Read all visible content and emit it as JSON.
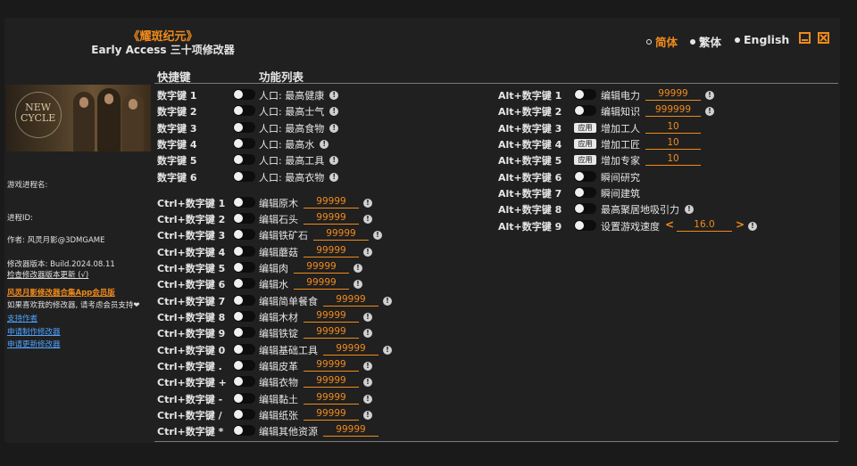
{
  "title": {
    "main": "《耀斑纪元》",
    "sub": "Early Access 三十项修改器"
  },
  "languages": [
    {
      "label": "简体",
      "selected": true
    },
    {
      "label": "繁体",
      "selected": false
    },
    {
      "label": "English",
      "selected": false
    }
  ],
  "headers": {
    "hotkey": "快捷键",
    "features": "功能列表"
  },
  "banner": {
    "logo_line1": "NEW",
    "logo_line2": "CYCLE"
  },
  "sidebar": {
    "process_label": "游戏进程名:",
    "pid_label": "进程ID:",
    "author": "作者: 风灵月影@3DMGAME",
    "version": "修改器版本: Build.2024.08.11",
    "check_update": "检查修改器版本更新 (√)",
    "app_link": "风灵月影修改器合集App会员版",
    "support_text": "如果喜欢我的修改器, 请考虑会员支持❤",
    "support_author": "支持作者",
    "request_trainer": "申请制作修改器",
    "request_update": "申请更新修改器"
  },
  "left_rows": [
    {
      "key": "数字键 1",
      "label": "人口: 最高健康",
      "value": "",
      "info": true
    },
    {
      "key": "数字键 2",
      "label": "人口: 最高士气",
      "value": "",
      "info": true
    },
    {
      "key": "数字键 3",
      "label": "人口: 最高食物",
      "value": "",
      "info": true
    },
    {
      "key": "数字键 4",
      "label": "人口: 最高水",
      "value": "",
      "info": true
    },
    {
      "key": "数字键 5",
      "label": "人口: 最高工具",
      "value": "",
      "info": true
    },
    {
      "key": "数字键 6",
      "label": "人口: 最高衣物",
      "value": "",
      "info": true
    },
    {
      "key": "Ctrl+数字键 1",
      "label": "编辑原木",
      "value": "99999",
      "info": true
    },
    {
      "key": "Ctrl+数字键 2",
      "label": "编辑石头",
      "value": "99999",
      "info": true
    },
    {
      "key": "Ctrl+数字键 3",
      "label": "编辑铁矿石",
      "value": "99999",
      "info": true
    },
    {
      "key": "Ctrl+数字键 4",
      "label": "编辑蘑菇",
      "value": "99999",
      "info": true
    },
    {
      "key": "Ctrl+数字键 5",
      "label": "编辑肉",
      "value": "99999",
      "info": true
    },
    {
      "key": "Ctrl+数字键 6",
      "label": "编辑水",
      "value": "99999",
      "info": true
    },
    {
      "key": "Ctrl+数字键 7",
      "label": "编辑简单餐食",
      "value": "99999",
      "info": true
    },
    {
      "key": "Ctrl+数字键 8",
      "label": "编辑木材",
      "value": "99999",
      "info": true
    },
    {
      "key": "Ctrl+数字键 9",
      "label": "编辑铁锭",
      "value": "99999",
      "info": true
    },
    {
      "key": "Ctrl+数字键 0",
      "label": "编辑基础工具",
      "value": "99999",
      "info": true
    },
    {
      "key": "Ctrl+数字键 .",
      "label": "编辑皮革",
      "value": "99999",
      "info": true
    },
    {
      "key": "Ctrl+数字键 +",
      "label": "编辑衣物",
      "value": "99999",
      "info": true
    },
    {
      "key": "Ctrl+数字键 -",
      "label": "编辑黏土",
      "value": "99999",
      "info": true
    },
    {
      "key": "Ctrl+数字键 /",
      "label": "编辑纸张",
      "value": "99999",
      "info": true
    },
    {
      "key": "Ctrl+数字键 *",
      "label": "编辑其他资源",
      "value": "99999",
      "info": false
    }
  ],
  "right_rows": [
    {
      "key": "Alt+数字键 1",
      "control": "toggle",
      "label": "编辑电力",
      "value": "99999",
      "info": true
    },
    {
      "key": "Alt+数字键 2",
      "control": "toggle",
      "label": "编辑知识",
      "value": "999999",
      "info": true
    },
    {
      "key": "Alt+数字键 3",
      "control": "apply",
      "apply_label": "应用",
      "label": "增加工人",
      "value": "10",
      "info": false
    },
    {
      "key": "Alt+数字键 4",
      "control": "apply",
      "apply_label": "应用",
      "label": "增加工匠",
      "value": "10",
      "info": false
    },
    {
      "key": "Alt+数字键 5",
      "control": "apply",
      "apply_label": "应用",
      "label": "增加专家",
      "value": "10",
      "info": false
    },
    {
      "key": "Alt+数字键 6",
      "control": "toggle",
      "label": "瞬间研究",
      "value": "",
      "info": false
    },
    {
      "key": "Alt+数字键 7",
      "control": "toggle",
      "label": "瞬间建筑",
      "value": "",
      "info": false
    },
    {
      "key": "Alt+数字键 8",
      "control": "toggle",
      "label": "最高聚居地吸引力",
      "value": "",
      "info": true
    },
    {
      "key": "Alt+数字键 9",
      "control": "toggle",
      "label": "设置游戏速度",
      "value": "16.0",
      "info": true,
      "arrows": true
    }
  ],
  "colors": {
    "accent": "#f08a1c",
    "link": "#4fa3ff",
    "background": "#202020"
  },
  "icons": {
    "info": "info-icon",
    "minimize": "minimize-icon",
    "close": "close-icon"
  }
}
